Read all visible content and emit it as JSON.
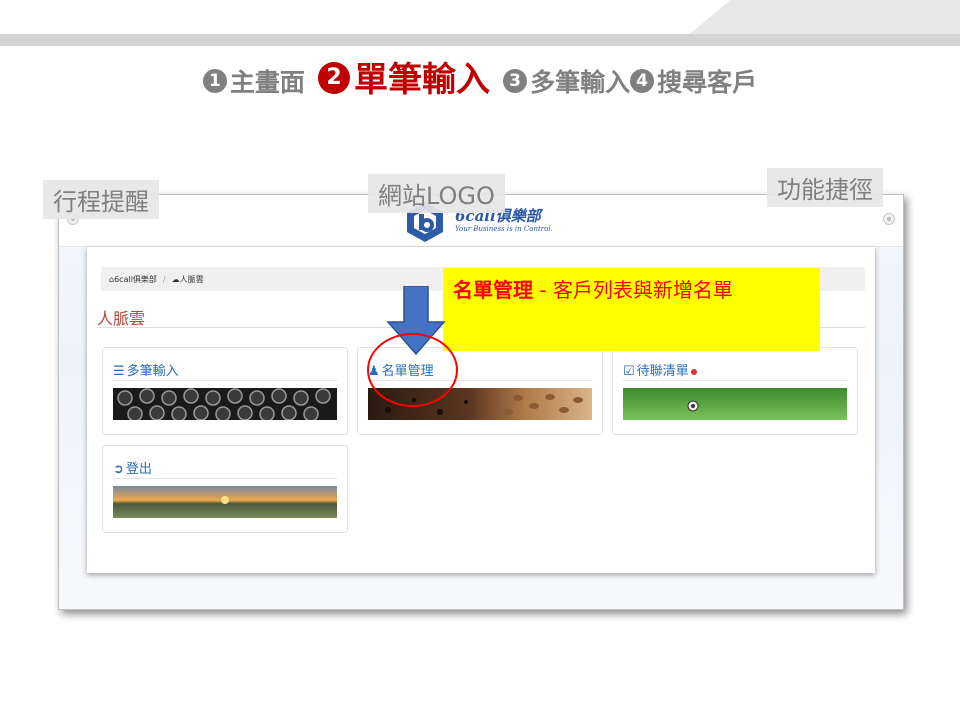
{
  "steps": [
    {
      "num": "1",
      "label": "主畫面",
      "active": false
    },
    {
      "num": "2",
      "label": "單筆輸入",
      "active": true
    },
    {
      "num": "3",
      "label": "多筆輸入",
      "active": false
    },
    {
      "num": "4",
      "label": "搜尋客戶",
      "active": false
    }
  ],
  "labels": {
    "reminder": "行程提醒",
    "site_logo": "網站LOGO",
    "shortcut": "功能捷徑"
  },
  "site": {
    "logo_name": "6call俱樂部",
    "logo_tagline": "Your Business is in Control."
  },
  "breadcrumb": {
    "home": "6call俱樂部",
    "current": "人脈雲"
  },
  "page_title": "人脈雲",
  "cards": [
    {
      "label": "多筆輸入",
      "icon": "list-icon",
      "image": "typewriter-keys"
    },
    {
      "label": "名單管理",
      "icon": "users-icon",
      "image": "coffee-beans"
    },
    {
      "label": "待聯清單",
      "icon": "calendar-check-icon",
      "image": "grass-ball"
    },
    {
      "label": "登出",
      "icon": "share-out-icon",
      "image": "sunset-field"
    }
  ],
  "annotation": {
    "bold": "名單管理",
    "dash": " - ",
    "text": "客戶列表與新增名單"
  },
  "colors": {
    "active_step": "#c00000",
    "inactive_step": "#808080",
    "link_blue": "#2a6ebb",
    "note_bg": "#ffff00",
    "note_text": "#ff0000",
    "arrow_blue": "#4472c4"
  }
}
